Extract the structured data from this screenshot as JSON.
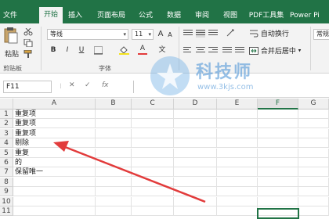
{
  "tabs": [
    {
      "label": "文件",
      "active": false
    },
    {
      "label": "开始",
      "active": true
    },
    {
      "label": "插入",
      "active": false
    },
    {
      "label": "页面布局",
      "active": false
    },
    {
      "label": "公式",
      "active": false
    },
    {
      "label": "数据",
      "active": false
    },
    {
      "label": "审阅",
      "active": false
    },
    {
      "label": "视图",
      "active": false
    },
    {
      "label": "PDF工具集",
      "active": false
    },
    {
      "label": "Power Pi",
      "active": false
    }
  ],
  "ribbon": {
    "paste_label": "粘贴",
    "clipboard_group": "剪贴板",
    "font_name": "等线",
    "font_size": "11",
    "font_group": "字体",
    "wrap_text": "自动换行",
    "merge_center": "合并后居中",
    "number_format": "常规",
    "bold": "B",
    "italic": "I",
    "underline": "U",
    "grow_font": "A",
    "shrink_font": "A",
    "font_color": "A",
    "wen": "文",
    "dropdown": "▾"
  },
  "formula_bar": {
    "name_box": "F11",
    "cancel": "✕",
    "confirm": "✓",
    "fx": "fx"
  },
  "columns": [
    "A",
    "B",
    "C",
    "D",
    "E",
    "F",
    "G"
  ],
  "selected_column": "F",
  "rows": [
    {
      "num": "1",
      "a": "重复项"
    },
    {
      "num": "2",
      "a": "重复项"
    },
    {
      "num": "3",
      "a": "重复项"
    },
    {
      "num": "4",
      "a": "剔除"
    },
    {
      "num": "5",
      "a": "重复"
    },
    {
      "num": "6",
      "a": "的"
    },
    {
      "num": "7",
      "a": "保留唯一"
    },
    {
      "num": "8",
      "a": ""
    },
    {
      "num": "9",
      "a": ""
    },
    {
      "num": "10",
      "a": ""
    },
    {
      "num": "11",
      "a": ""
    }
  ],
  "watermark": {
    "title": "科技师",
    "url": "www.3kjs.com"
  },
  "colors": {
    "excel_green": "#217346",
    "arrow_red": "#e23b3b"
  }
}
